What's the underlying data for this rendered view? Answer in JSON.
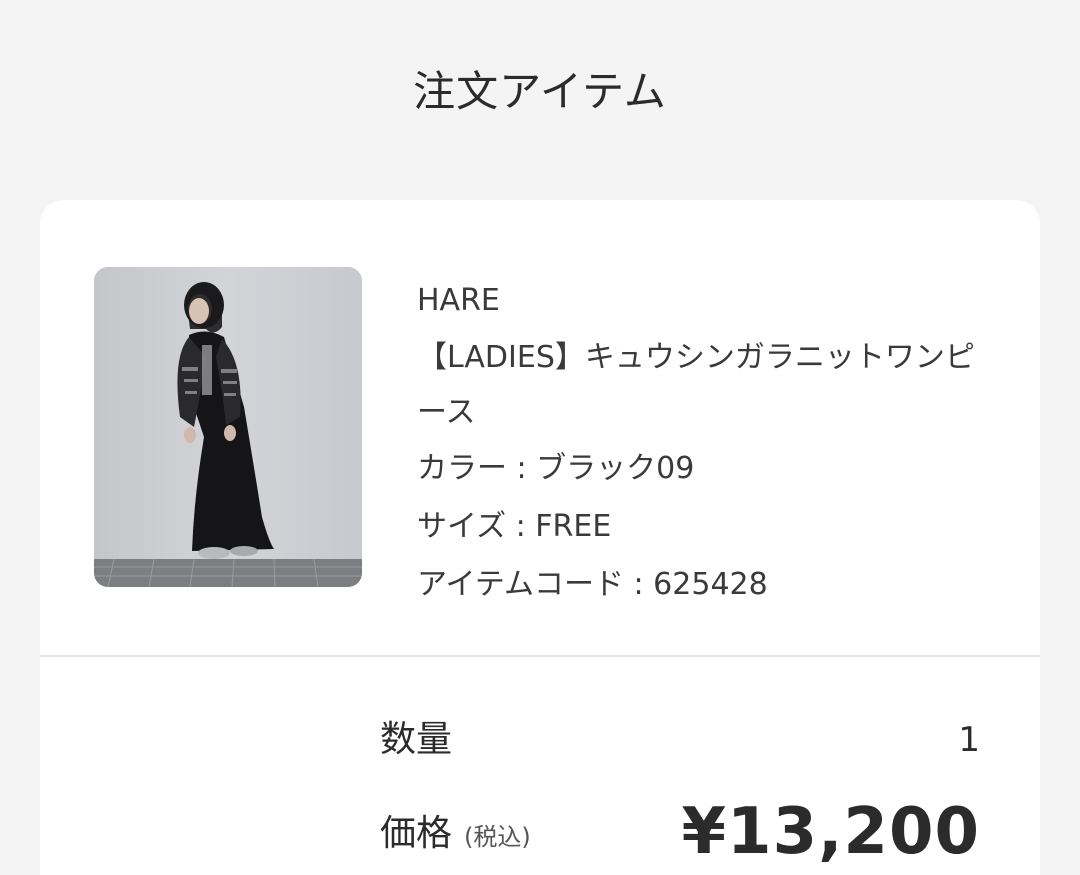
{
  "header": {
    "title": "注文アイテム"
  },
  "item": {
    "brand": "HARE",
    "name": "【LADIES】キュウシンガラニットワンピース",
    "color_line": "カラー : ブラック09",
    "size_line": "サイズ : FREE",
    "code_line": "アイテムコード : 625428",
    "image_alt": "product-photo"
  },
  "summary": {
    "quantity_label": "数量",
    "quantity_value": "1",
    "price_label": "価格",
    "tax_note": "(税込)",
    "price_value": "¥13,200"
  }
}
